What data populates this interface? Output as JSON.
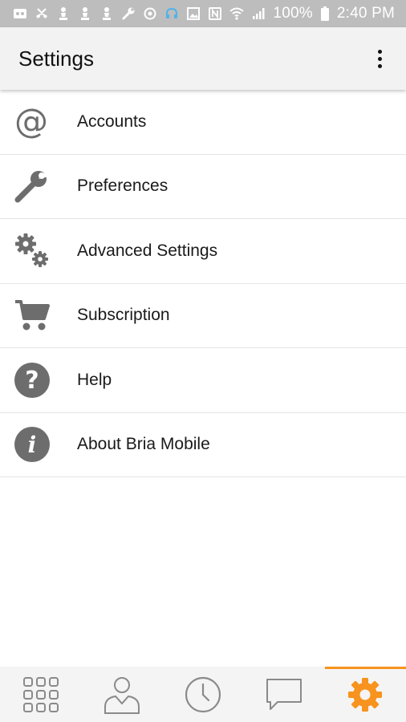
{
  "status_bar": {
    "battery": "100%",
    "time": "2:40 PM",
    "left_icons": [
      "voicemail-icon",
      "missed-call-icon",
      "chess-pawn-icon",
      "chess-pawn-icon",
      "chess-pawn-icon",
      "wrench-icon",
      "sync-icon",
      "headset-icon",
      "image-icon"
    ],
    "right_icons": [
      "nfc-icon",
      "wifi-icon",
      "signal-icon",
      "battery-icon"
    ]
  },
  "app_bar": {
    "title": "Settings",
    "overflow_icon": "more-vert-icon"
  },
  "settings": {
    "items": [
      {
        "label": "Accounts",
        "icon": "at-sign-icon"
      },
      {
        "label": "Preferences",
        "icon": "wrench-icon"
      },
      {
        "label": "Advanced Settings",
        "icon": "gears-icon"
      },
      {
        "label": "Subscription",
        "icon": "cart-icon"
      },
      {
        "label": "Help",
        "icon": "question-circle-icon"
      },
      {
        "label": "About Bria Mobile",
        "icon": "info-circle-icon"
      }
    ]
  },
  "bottom_nav": {
    "tabs": [
      {
        "icon": "dialpad-icon",
        "active": false
      },
      {
        "icon": "contacts-icon",
        "active": false
      },
      {
        "icon": "history-clock-icon",
        "active": false
      },
      {
        "icon": "chat-bubble-icon",
        "active": false
      },
      {
        "icon": "settings-gear-icon",
        "active": true
      }
    ]
  },
  "colors": {
    "accent": "#f7931e",
    "icon_gray": "#6d6d6d",
    "nav_gray": "#8a8a8a",
    "status_bar": "#bdbdbd",
    "app_bar": "#f2f2f2"
  }
}
